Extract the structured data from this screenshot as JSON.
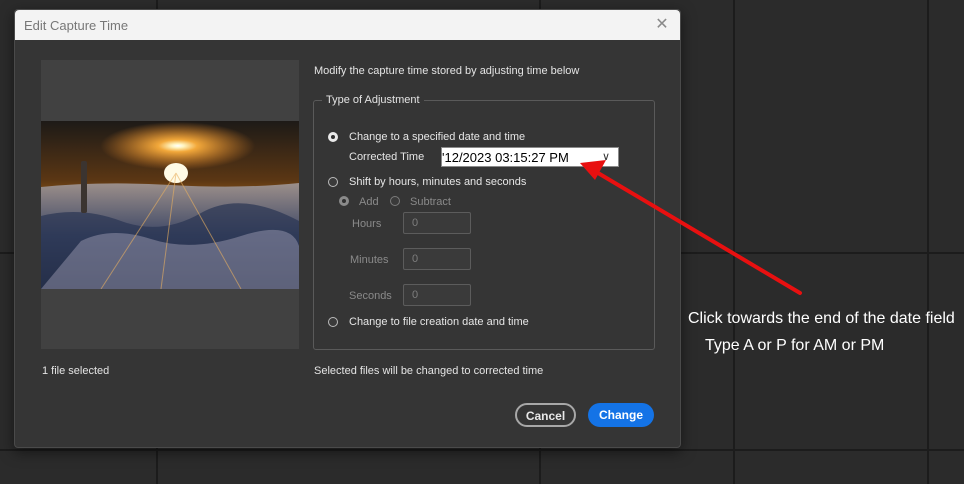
{
  "dialog": {
    "title": "Edit Capture Time",
    "close_glyph": "✕",
    "description": "Modify the capture time stored by adjusting time below",
    "file_count": "1 file selected",
    "footer_note": "Selected files will be changed to corrected time",
    "adjustment": {
      "legend": "Type of Adjustment",
      "option_specified": "Change to a specified date and time",
      "corrected_time_label": "Corrected Time",
      "corrected_time_value": "'12/2023  03:15:27 PM",
      "option_shift": "Shift by hours, minutes and seconds",
      "add_label": "Add",
      "subtract_label": "Subtract",
      "hours_label": "Hours",
      "hours_value": "0",
      "minutes_label": "Minutes",
      "minutes_value": "0",
      "seconds_label": "Seconds",
      "seconds_value": "0",
      "option_file_creation": "Change to file creation date and time"
    },
    "buttons": {
      "cancel": "Cancel",
      "change": "Change"
    }
  },
  "annotation": {
    "line1": "Click towards the end of the date field",
    "line2": "Type A or P for AM or PM"
  },
  "colors": {
    "accent": "#1473e6",
    "arrow": "#e81010"
  }
}
